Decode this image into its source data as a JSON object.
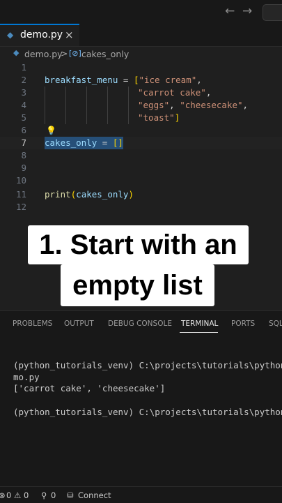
{
  "titlebar": {
    "back_icon": "arrow-left-icon",
    "forward_icon": "arrow-right-icon"
  },
  "tab": {
    "label": "demo.py",
    "close": "×"
  },
  "breadcrumb": {
    "file": "demo.py",
    "separator": ">",
    "symbol": "cakes_only"
  },
  "editor": {
    "line_numbers": [
      "1",
      "2",
      "3",
      "4",
      "5",
      "6",
      "7",
      "8",
      "9",
      "10",
      "11",
      "12"
    ],
    "code": {
      "l2_var": "breakfast_menu",
      "l2_op": " = ",
      "l2_open": "[",
      "l2_s1": "\"ice cream\"",
      "comma": ",",
      "l3_s": "\"carrot cake\"",
      "l4_s1": "\"eggs\"",
      "l4_s2": "\"cheesecake\"",
      "l5_s": "\"toast\"",
      "close": "]",
      "l7_var": "cakes_only",
      "l7_op": " = ",
      "l7_val": "[]",
      "l11_fn": "print",
      "l11_open": "(",
      "l11_arg": "cakes_only",
      "l11_close": ")"
    }
  },
  "caption": {
    "line1": "1. Start with an",
    "line2": "empty list"
  },
  "panel": {
    "tabs": [
      "PROBLEMS",
      "OUTPUT",
      "DEBUG CONSOLE",
      "TERMINAL",
      "PORTS",
      "SQL"
    ],
    "active_tab": "TERMINAL",
    "terminal_lines": [
      "(python_tutorials_venv) C:\\projects\\tutorials\\python>",
      "mo.py",
      "['carrot cake', 'cheesecake']",
      "",
      "(python_tutorials_venv) C:\\projects\\tutorials\\python>"
    ]
  },
  "statusbar": {
    "errors": "0",
    "warnings": "0",
    "ports": "0",
    "connect": "Connect"
  },
  "colors": {
    "accent": "#0078d4",
    "editor_bg": "#1f1f1f",
    "string": "#ce9178",
    "variable": "#9cdcfe"
  }
}
